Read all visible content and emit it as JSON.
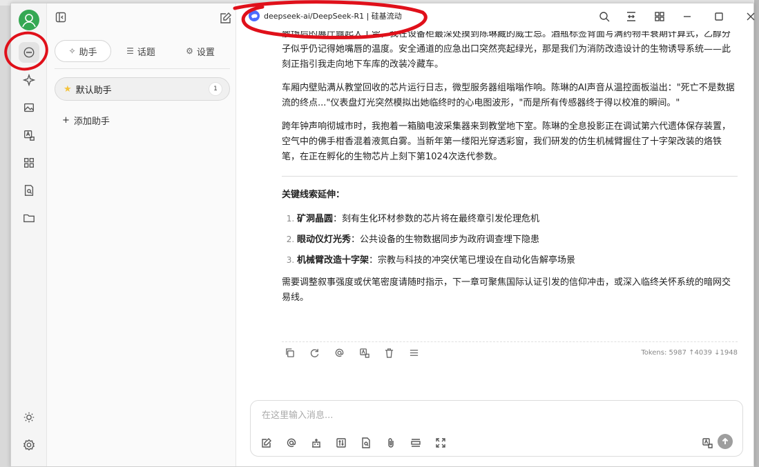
{
  "window": {
    "model_name": "deepseek-ai/DeepSeek-R1 | 硅基流动"
  },
  "sidebar": {
    "tabs": [
      {
        "label": "助手",
        "icon": "sparkle-icon"
      },
      {
        "label": "话题",
        "icon": "list-icon"
      },
      {
        "label": "设置",
        "icon": "gear-icon"
      }
    ],
    "assistants": [
      {
        "label": "默认助手",
        "count": "1"
      }
    ],
    "add_label": "添加助手"
  },
  "message": {
    "paragraphs": [
      "散场后的展厅飘起人工雪，我在设备柜最深处摸到陈琳藏的威士忌。酒瓶标签背面写满药物半衰期计算式，乙醇分子似乎仍记得她嘴唇的温度。安全通道的应急出口突然亮起绿光，那是我们为消防改造设计的生物诱导系统——此刻正指引我走向地下车库的改装冷藏车。",
      "车厢内壁贴满从教堂回收的芯片运行日志，微型服务器组嗡嗡作响。陈琳的AI声音从温控面板溢出：\"死亡不是数据流的终点...\"仪表盘灯光突然模拟出她临终时的心电图波形，\"而是所有传感器终于得以校准的瞬间。\"",
      "跨年钟声响彻城市时，我抱着一箱脑电波采集器来到教堂地下室。陈琳的全息投影正在调试第六代遗体保存装置，空气中的佛手柑香混着液氮白雾。当新年第一缕阳光穿透彩窗，我们研发的仿生机械臂握住了十字架改装的烙铁笔，在正在孵化的生物芯片上刻下第1024次迭代参数。"
    ],
    "heading": "关键线索延伸：",
    "clues": [
      {
        "title": "矿洞晶圆",
        "text": "：刻有生化环材参数的芯片将在最终章引发伦理危机"
      },
      {
        "title": "眼动仪灯光秀",
        "text": "：公共设备的生物数据同步为政府调查埋下隐患"
      },
      {
        "title": "机械臂改造十字架",
        "text": "：宗教与科技的冲突伏笔已埋设在自动化告解亭场景"
      }
    ],
    "closing": "需要调整叙事强度或伏笔密度请随时指示，下一章可聚焦国际认证引发的信仰冲击，或深入临终关怀系统的暗网交易线。",
    "tokens": "Tokens: 5987 ↑4039 ↓1948"
  },
  "composer": {
    "placeholder": "在这里输入消息..."
  },
  "colors": {
    "annotation": "#e0101a",
    "avatar": "#35a853",
    "deepseek": "#4d6bfe"
  }
}
